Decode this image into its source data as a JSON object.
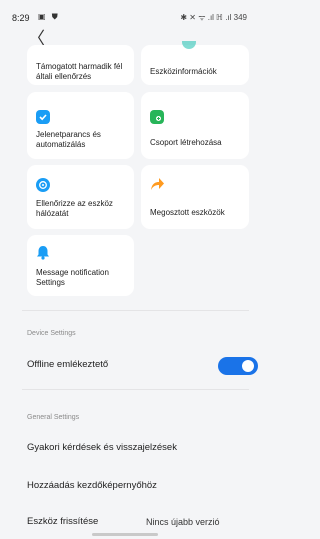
{
  "status_bar": {
    "time": "8:29",
    "left_icons": "▣ ⛊",
    "right_text": "✱ ✕ ᯤ .ıl ℍ .ıl 349"
  },
  "nav": {
    "back_glyph": "〈"
  },
  "cards": [
    {
      "id": "third-party",
      "label": "Támogatott harmadik fél általi ellenőrzés",
      "icon": "partial-icon",
      "color": "#2ec4b6"
    },
    {
      "id": "device-info",
      "label": "Eszközinformációk",
      "icon": "info-icon",
      "color": "#2ec4b6"
    },
    {
      "id": "scene",
      "label": "Jelenetparancs és automatizálás",
      "icon": "checkmark-icon",
      "color": "#1a9df5"
    },
    {
      "id": "create-group",
      "label": "Csoport létrehozása",
      "icon": "group-add-icon",
      "color": "#27b559"
    },
    {
      "id": "network-check",
      "label": "Ellenőrizze az eszköz hálózatát",
      "icon": "wifi-check-icon",
      "color": "#1a9df5"
    },
    {
      "id": "shared-devices",
      "label": "Megosztott eszközök",
      "icon": "share-arrow-icon",
      "color": "#ff9a1f"
    },
    {
      "id": "message-notification",
      "label": "Message notification Settings",
      "icon": "bell-icon",
      "color": "#1a9df5"
    }
  ],
  "device_settings": {
    "section_label": "Device Settings",
    "offline_reminder": {
      "label": "Offline emlékeztető",
      "enabled": true
    }
  },
  "general_settings": {
    "section_label": "General Settings",
    "faq": "Gyakori kérdések és visszajelzések",
    "add_home": "Hozzáadás kezdőképernyőhöz",
    "firmware": {
      "label": "Eszköz frissítése",
      "value": "Nincs újabb verzió"
    }
  },
  "colors": {
    "accent": "#1a73e8",
    "background": "#f4f5f7"
  }
}
